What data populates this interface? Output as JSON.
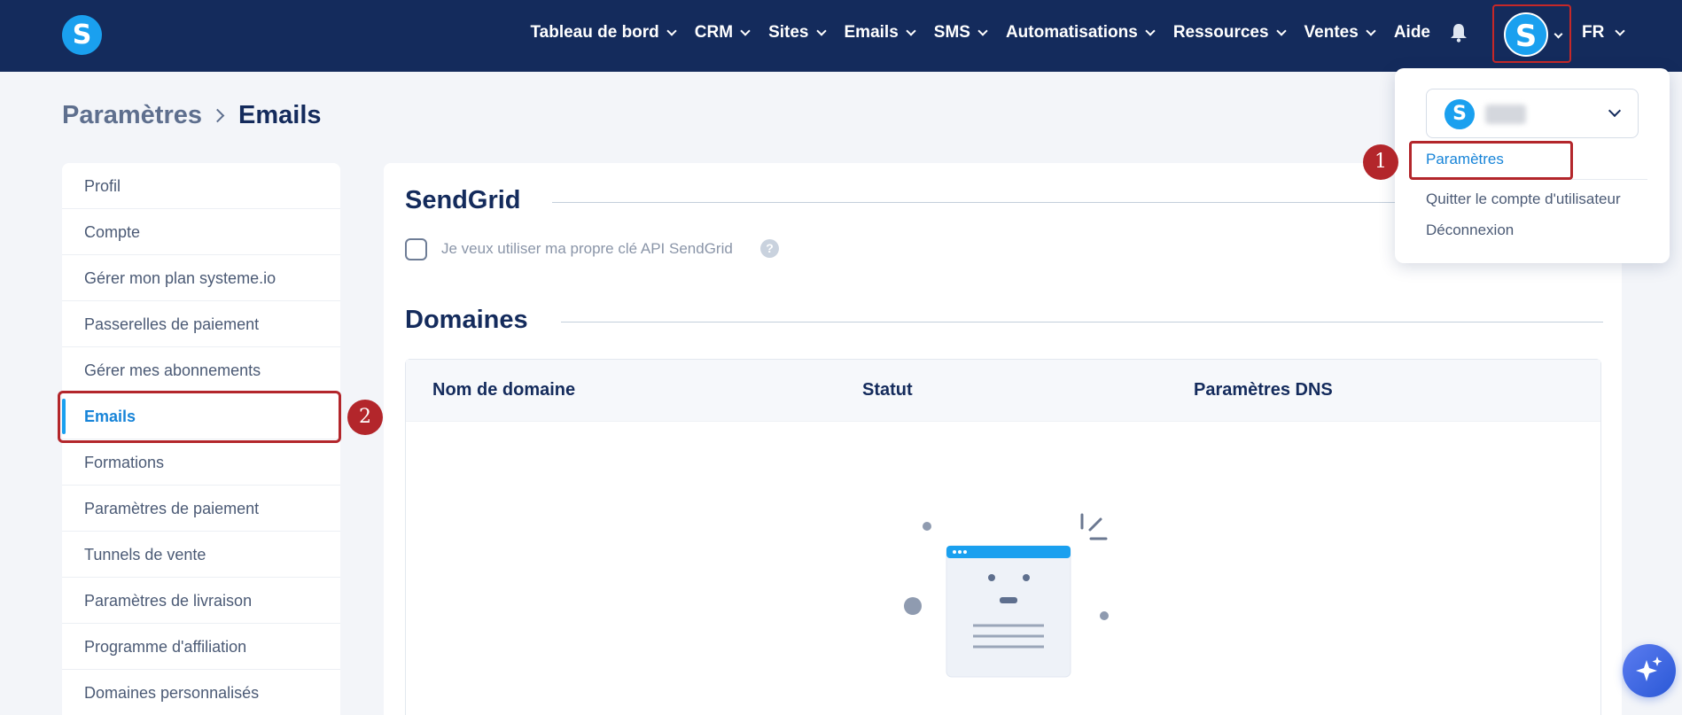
{
  "logo": {
    "letter": "S"
  },
  "nav": {
    "items": [
      {
        "label": "Tableau de bord"
      },
      {
        "label": "CRM"
      },
      {
        "label": "Sites"
      },
      {
        "label": "Emails"
      },
      {
        "label": "SMS"
      },
      {
        "label": "Automatisations"
      },
      {
        "label": "Ressources"
      },
      {
        "label": "Ventes"
      }
    ],
    "help_label": "Aide",
    "avatar_letter": "S",
    "language": "FR"
  },
  "breadcrumb": {
    "parent": "Paramètres",
    "current": "Emails"
  },
  "sidebar": {
    "items": [
      {
        "label": "Profil"
      },
      {
        "label": "Compte"
      },
      {
        "label": "Gérer mon plan systeme.io"
      },
      {
        "label": "Passerelles de paiement"
      },
      {
        "label": "Gérer mes abonnements"
      },
      {
        "label": "Emails"
      },
      {
        "label": "Formations"
      },
      {
        "label": "Paramètres de paiement"
      },
      {
        "label": "Tunnels de vente"
      },
      {
        "label": "Paramètres de livraison"
      },
      {
        "label": "Programme d'affiliation"
      },
      {
        "label": "Domaines personnalisés"
      }
    ],
    "active_index": 5
  },
  "sendgrid": {
    "title": "SendGrid",
    "checkbox_label": "Je veux utiliser ma propre clé API SendGrid",
    "help_glyph": "?"
  },
  "domains": {
    "title": "Domaines",
    "columns": [
      "Nom de domaine",
      "Statut",
      "Paramètres DNS"
    ]
  },
  "account_menu": {
    "account_logo_letter": "S",
    "settings_label": "Paramètres",
    "leave_label": "Quitter le compte d'utilisateur",
    "logout_label": "Déconnexion"
  },
  "annotations": {
    "step1": "1",
    "step2": "2"
  },
  "colors": {
    "nav_bg": "#142b5c",
    "accent": "#1aa0ef",
    "highlight": "#b3262b"
  }
}
